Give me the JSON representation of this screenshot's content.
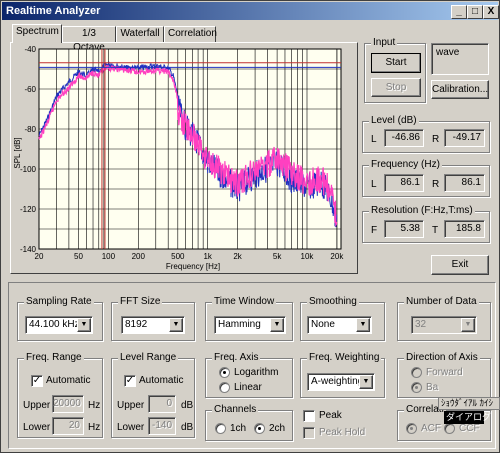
{
  "window": {
    "title": "Realtime Analyzer",
    "controls": [
      "_",
      "□",
      "X"
    ]
  },
  "tabs": [
    {
      "label": "Spectrum",
      "active": true
    },
    {
      "label": "1/3 Octave",
      "active": false
    },
    {
      "label": "Waterfall",
      "active": false
    },
    {
      "label": "Correlation",
      "active": false
    }
  ],
  "chart_data": {
    "type": "line",
    "xlabel": "Frequency  [Hz]",
    "ylabel": "SPL [dB]",
    "x_scale": "log",
    "xlim": [
      20,
      22000
    ],
    "ylim": [
      -140,
      -40
    ],
    "x_ticks": [
      "20",
      "50",
      "100",
      "200",
      "500",
      "1k",
      "2k",
      "5k",
      "10k",
      "20k"
    ],
    "y_ticks": [
      "-40",
      "-60",
      "-80",
      "-100",
      "-120",
      "-140"
    ],
    "grid": true,
    "markers": {
      "level_L_db": -46.86,
      "level_R_db": -49.17,
      "freq_hz": 86.1
    },
    "colors": {
      "L": "#2030c0",
      "R": "#ff40c0",
      "marker": "#c03030",
      "grid": "#000000",
      "plot_bg": "#fffff0"
    },
    "series": [
      {
        "name": "L",
        "x": [
          20,
          25,
          30,
          40,
          50,
          60,
          70,
          80,
          90,
          100,
          150,
          200,
          300,
          400,
          450,
          500,
          600,
          800,
          1000,
          1500,
          2000,
          3000,
          5000,
          7000,
          10000,
          14000,
          16000,
          18000,
          20000
        ],
        "values": [
          -82,
          -72,
          -62,
          -55,
          -50,
          -52,
          -49,
          -50,
          -47,
          -46,
          -48,
          -48,
          -47,
          -48,
          -52,
          -62,
          -72,
          -80,
          -90,
          -98,
          -103,
          -96,
          -90,
          -98,
          -102,
          -100,
          -104,
          -110,
          -122
        ]
      },
      {
        "name": "R",
        "x": [
          20,
          25,
          30,
          40,
          50,
          60,
          70,
          80,
          90,
          100,
          150,
          200,
          300,
          400,
          450,
          500,
          600,
          800,
          1000,
          1500,
          2000,
          3000,
          5000,
          7000,
          10000,
          14000,
          16000,
          18000,
          20000
        ],
        "values": [
          -84,
          -74,
          -64,
          -58,
          -52,
          -53,
          -50,
          -52,
          -49,
          -48,
          -49,
          -50,
          -49,
          -50,
          -54,
          -64,
          -72,
          -80,
          -88,
          -96,
          -100,
          -94,
          -88,
          -95,
          -100,
          -98,
          -102,
          -108,
          -118
        ]
      }
    ]
  },
  "input": {
    "title": "Input",
    "start": "Start",
    "stop": "Stop",
    "source": "wave",
    "calibration": "Calibration..."
  },
  "level": {
    "title": "Level (dB)",
    "l_label": "L",
    "l_value": "-46.86",
    "r_label": "R",
    "r_value": "-49.17"
  },
  "frequency": {
    "title": "Frequency (Hz)",
    "l_label": "L",
    "l_value": "86.1",
    "r_label": "R",
    "r_value": "86.1"
  },
  "resolution": {
    "title": "Resolution (F:Hz,T:ms)",
    "f_label": "F",
    "f_value": "5.38",
    "t_label": "T",
    "t_value": "185.8"
  },
  "exit": "Exit",
  "sampling_rate": {
    "title": "Sampling Rate",
    "value": "44.100 kHz"
  },
  "fft_size": {
    "title": "FFT Size",
    "value": "8192"
  },
  "time_window": {
    "title": "Time Window",
    "value": "Hamming"
  },
  "smoothing": {
    "title": "Smoothing",
    "value": "None"
  },
  "number_of_data": {
    "title": "Number of Data",
    "value": "32"
  },
  "freq_range": {
    "title": "Freq. Range",
    "automatic": "Automatic",
    "upper_label": "Upper",
    "upper_value": "20000",
    "upper_unit": "Hz",
    "lower_label": "Lower",
    "lower_value": "20",
    "lower_unit": "Hz"
  },
  "level_range": {
    "title": "Level Range",
    "automatic": "Automatic",
    "upper_label": "Upper",
    "upper_value": "0",
    "upper_unit": "dB",
    "lower_label": "Lower",
    "lower_value": "-140",
    "lower_unit": "dB"
  },
  "freq_axis": {
    "title": "Freq. Axis",
    "logarithm": "Logarithm",
    "linear": "Linear"
  },
  "freq_weighting": {
    "title": "Freq. Weighting",
    "value": "A-weighting"
  },
  "direction_of_axis": {
    "title": "Direction of Axis",
    "forward": "Forward",
    "backward": "Ba"
  },
  "channels": {
    "title": "Channels",
    "ch1": "1ch",
    "ch2": "2ch"
  },
  "peak": {
    "peak": "Peak",
    "peak_hold": "Peak Hold"
  },
  "correlation": {
    "title": "Correlati",
    "acf": "ACF",
    "ccf": "CCF"
  },
  "ime_overlay": {
    "line1": "ｼｮｳﾀﾞｲｱﾙ ｶｲｼ",
    "line2": "ダイアログ"
  }
}
